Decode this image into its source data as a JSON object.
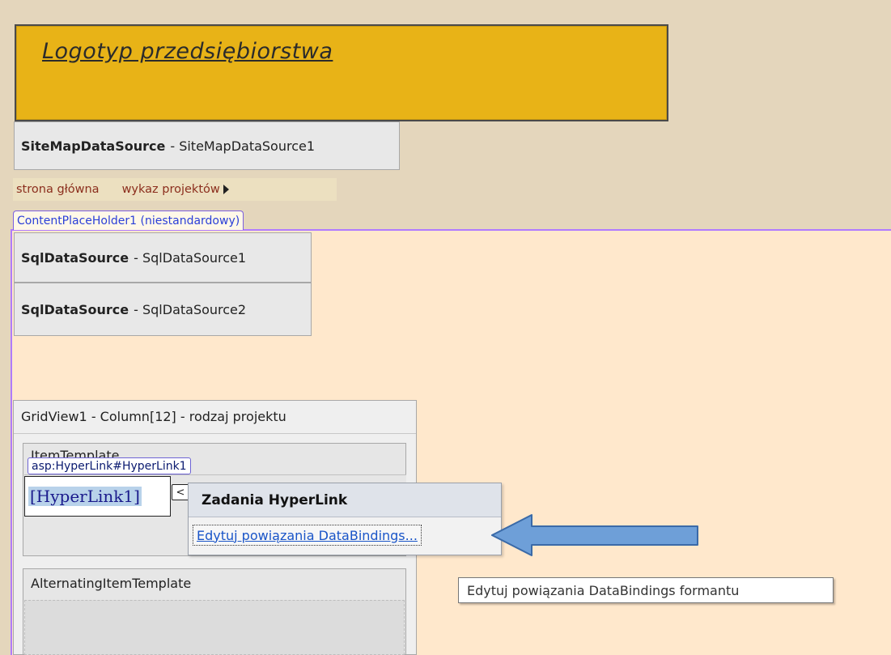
{
  "header": {
    "logo_text": "Logotyp przedsiębiorstwa"
  },
  "sitemap_datasource": {
    "type": "SiteMapDataSource",
    "name": "- SiteMapDataSource1"
  },
  "menu": {
    "items": [
      "strona główna",
      "wykaz projektów"
    ]
  },
  "content_placeholder": {
    "label": "ContentPlaceHolder1 (niestandardowy)"
  },
  "sql_datasources": [
    {
      "type": "SqlDataSource",
      "name": "- SqlDataSource1"
    },
    {
      "type": "SqlDataSource",
      "name": "- SqlDataSource2"
    }
  ],
  "gridview": {
    "title": "GridView1 - Column[12] - rodzaj projektu",
    "item_template_label": "ItemTemplate",
    "alt_template_label": "AlternatingItemTemplate"
  },
  "hyperlink": {
    "tag": "asp:HyperLink#HyperLink1",
    "text": "[HyperLink1]",
    "smart_tag_glyph": "<"
  },
  "tasks_popup": {
    "title": "Zadania HyperLink",
    "action": "Edytuj powiązania DataBindings..."
  },
  "tooltip": {
    "text": "Edytuj powiązania DataBindings formantu"
  },
  "colors": {
    "logo_bg": "#e8b317",
    "content_bg": "#ffe8cc",
    "master_bg": "#e4d6bc",
    "arrow_fill": "#6e9fd8",
    "link": "#1a55c8"
  }
}
